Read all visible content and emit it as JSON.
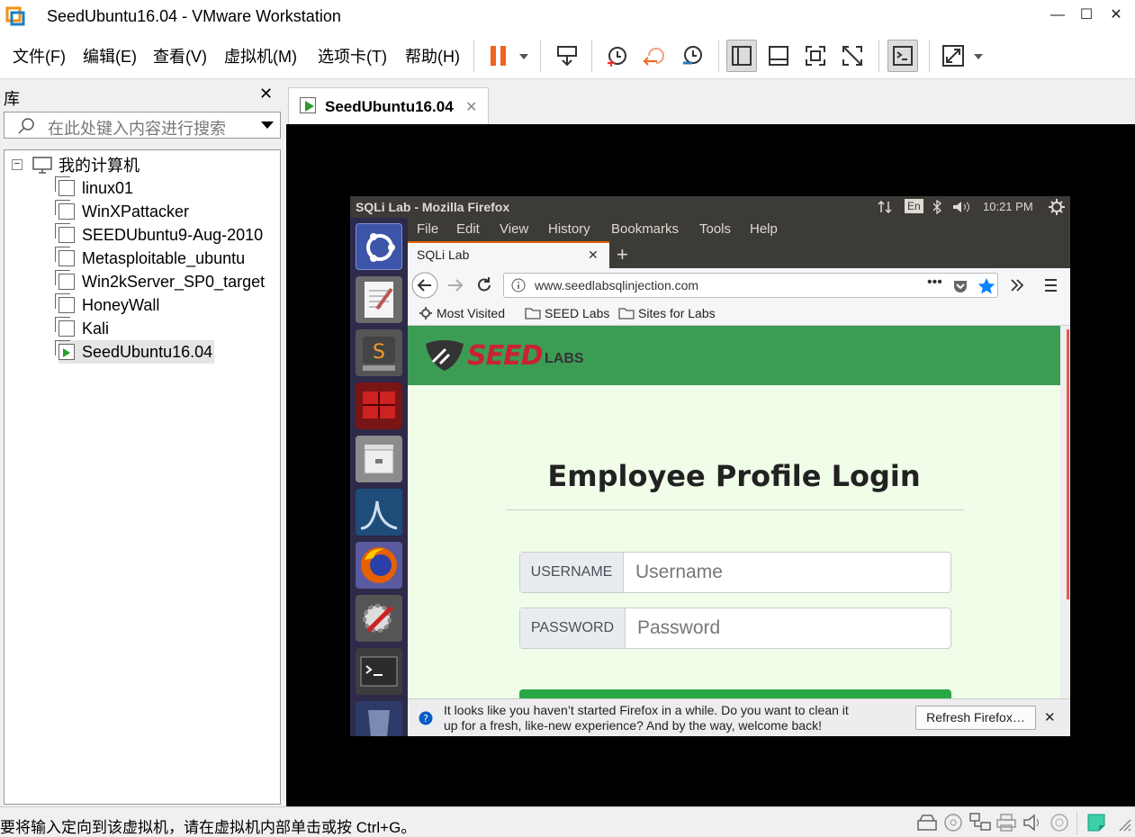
{
  "window": {
    "title": "SeedUbuntu16.04 - VMware Workstation",
    "minimize": "—",
    "maximize": "☐",
    "close": "✕"
  },
  "menu": [
    "文件(F)",
    "编辑(E)",
    "查看(V)",
    "虚拟机(M)",
    "选项卡(T)",
    "帮助(H)"
  ],
  "library": {
    "title": "库",
    "close": "✕",
    "search_placeholder": "在此处键入内容进行搜索",
    "root": "我的计算机",
    "items": [
      "linux01",
      "WinXPattacker",
      "SEEDUbuntu9-Aug-2010",
      "Metasploitable_ubuntu",
      "Win2kServer_SP0_target",
      "HoneyWall",
      "Kali",
      "SeedUbuntu16.04"
    ]
  },
  "vm_tab": {
    "label": "SeedUbuntu16.04",
    "close": "✕"
  },
  "status": {
    "text": "要将输入定向到该虚拟机，请在虚拟机内部单击或按 Ctrl+G。"
  },
  "guest": {
    "topbar": {
      "title": "SQLi Lab - Mozilla Firefox",
      "lang": "En",
      "time": "10:21 PM"
    },
    "ff_menu": [
      "File",
      "Edit",
      "View",
      "History",
      "Bookmarks",
      "Tools",
      "Help"
    ],
    "tab": {
      "label": "SQLi Lab",
      "close": "✕",
      "new": "+"
    },
    "url": "www.seedlabsqlinjection.com",
    "bookmarks": [
      "Most Visited",
      "SEED Labs",
      "Sites for Labs"
    ],
    "page": {
      "logo": "SEED",
      "logo_sub": "LABS",
      "heading": "Employee Profile Login",
      "username_label": "USERNAME",
      "username_placeholder": "Username",
      "password_label": "PASSWORD",
      "password_placeholder": "Password"
    },
    "notification": {
      "line1": "It looks like you haven’t started Firefox in a while. Do you want to clean it",
      "line2": "up for a fresh, like-new experience? And by the way, welcome back!",
      "button": "Refresh Firefox…",
      "close": "✕"
    }
  }
}
